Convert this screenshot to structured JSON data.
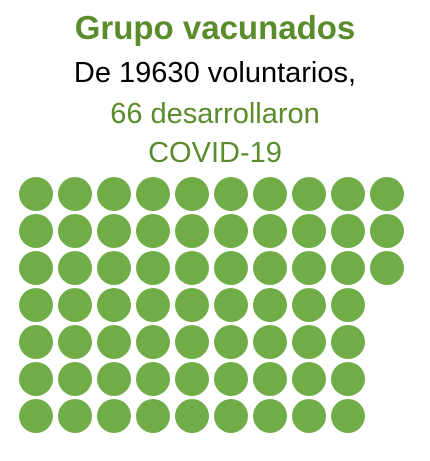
{
  "title": "Grupo vacunados",
  "subtitle_line1": "De 19630 voluntarios,",
  "subtitle_line2": "66 desarrollaron",
  "subtitle_line3": "COVID-19",
  "colors": {
    "accent": "#5a8c2c",
    "dot": "#70ad47",
    "text": "#000000"
  },
  "chart_data": {
    "type": "dot-matrix",
    "title": "Grupo vacunados",
    "total_volunteers": 19630,
    "cases": 66,
    "dots": 66,
    "columns": 10,
    "rows": 7,
    "fill_order": "column-major"
  }
}
